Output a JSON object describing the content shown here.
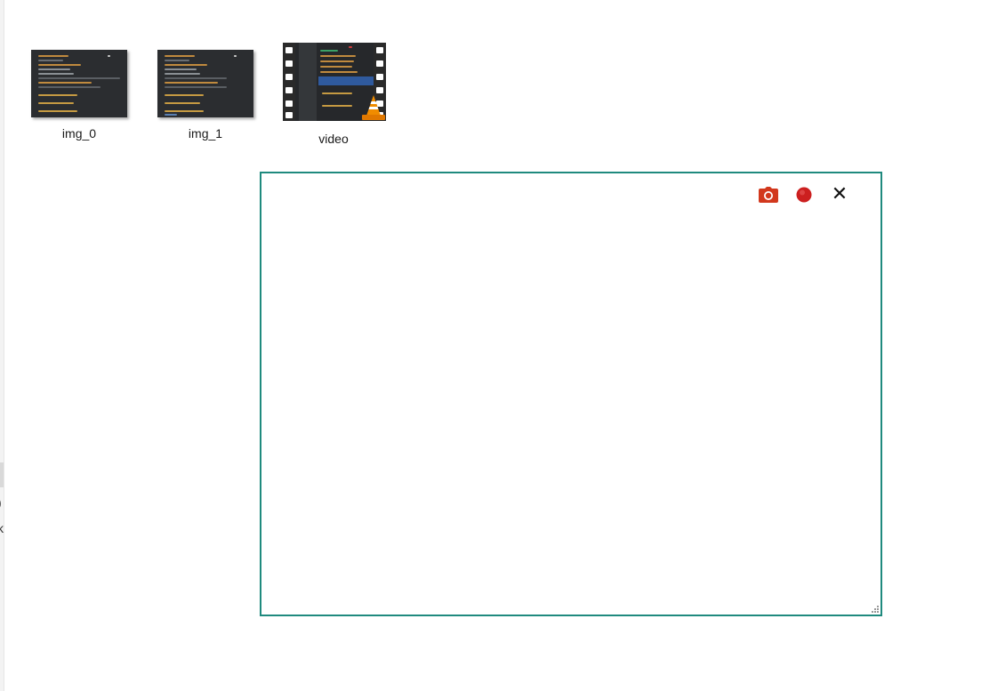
{
  "files": [
    {
      "name": "img_0",
      "type": "image"
    },
    {
      "name": "img_1",
      "type": "image"
    },
    {
      "name": "video",
      "type": "video"
    }
  ],
  "capture": {
    "border_color": "#1f8a7e",
    "buttons": [
      {
        "name": "screenshot",
        "icon": "camera-icon",
        "color": "#d2381d"
      },
      {
        "name": "record",
        "icon": "record-icon",
        "color": "#cc1f1f"
      },
      {
        "name": "close",
        "icon": "close-icon",
        "glyph": "✕"
      }
    ]
  },
  "left_edge": {
    "glyphs": [
      "l",
      ")",
      "k"
    ]
  }
}
